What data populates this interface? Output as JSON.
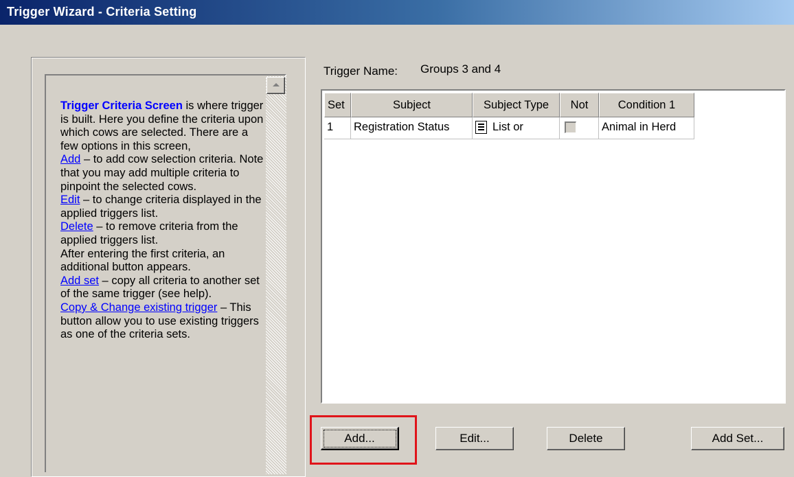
{
  "window": {
    "title": "Trigger Wizard - Criteria Setting"
  },
  "help": {
    "heading": "Trigger Criteria Screen",
    "intro": " is where trigger is built. Here you define the criteria upon which cows are selected. There are a few options in this screen,",
    "add_link": "Add",
    "add_text": " – to add cow selection criteria. Note that you may add multiple criteria to pinpoint the selected cows.",
    "edit_link": "Edit",
    "edit_text": " – to change criteria displayed in the applied triggers list.",
    "delete_link": "Delete",
    "delete_text": " – to remove criteria from the applied triggers list.",
    "after_text": "After entering the first criteria, an additional button appears.",
    "addset_link": "Add set",
    "addset_text": " – copy all criteria to another set of the same trigger (see help).",
    "copy_link": "Copy & Change existing trigger",
    "copy_text": " – This button allow you to use existing triggers as one of the criteria sets."
  },
  "trigger": {
    "name_label": "Trigger Name:",
    "name_value": "Groups 3 and 4"
  },
  "grid": {
    "columns": [
      "Set",
      "Subject",
      "Subject Type",
      "Not",
      "Condition 1"
    ],
    "rows": [
      {
        "set": "1",
        "subject": "Registration Status",
        "subject_type": "List or",
        "subject_type_icon": "list-icon",
        "not": false,
        "condition1": "Animal in Herd"
      }
    ]
  },
  "buttons": {
    "add": "Add...",
    "edit": "Edit...",
    "delete": "Delete",
    "add_set": "Add Set..."
  },
  "colors": {
    "highlight": "#e0141a",
    "link": "#0000ff",
    "title_bar": "#0a246a"
  }
}
